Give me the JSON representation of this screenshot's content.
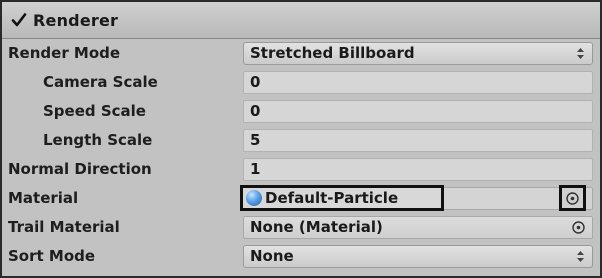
{
  "component": {
    "title": "Renderer",
    "enabled": true
  },
  "rows": [
    {
      "label": "Render Mode",
      "value": "Stretched Billboard",
      "kind": "dropdown"
    },
    {
      "label": "Camera Scale",
      "value": "0",
      "kind": "input"
    },
    {
      "label": "Speed Scale",
      "value": "0",
      "kind": "input"
    },
    {
      "label": "Length Scale",
      "value": "5",
      "kind": "input"
    },
    {
      "label": "Normal Direction",
      "value": "1",
      "kind": "input"
    },
    {
      "label": "Material",
      "value": "Default-Particle",
      "kind": "object"
    },
    {
      "label": "Trail Material",
      "value": "None (Material)",
      "kind": "object"
    },
    {
      "label": "Sort Mode",
      "value": "None",
      "kind": "dropdown"
    }
  ],
  "icons": {
    "checkbox": "checkmark-icon",
    "dropdown": "updown-arrows-icon",
    "object_picker": "object-picker-icon",
    "material": "material-sphere-icon"
  },
  "colors": {
    "panel_bg": "#c2c2c2",
    "highlight_border": "#111111",
    "sphere_blue": "#5aa0e6"
  }
}
